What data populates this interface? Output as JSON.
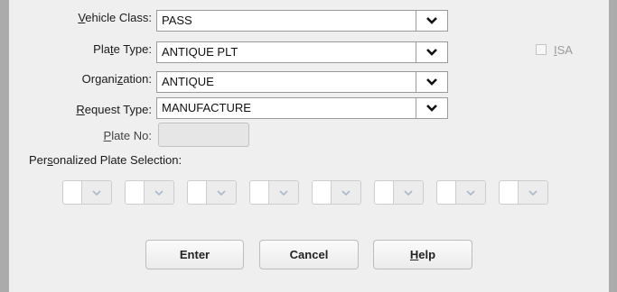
{
  "form": {
    "vehicle_class": {
      "label": "Vehicle Class:",
      "value": "PASS"
    },
    "plate_type": {
      "label": "Plate Type:",
      "value": "ANTIQUE PLT"
    },
    "organization": {
      "label": "Organization:",
      "value": "ANTIQUE"
    },
    "request_type": {
      "label": "Request Type:",
      "value": "MANUFACTURE"
    },
    "plate_no": {
      "label": "Plate No:",
      "value": ""
    },
    "isa": {
      "label": "ISA",
      "checked": false,
      "disabled": true
    },
    "personalized": {
      "label": "Personalized Plate Selection:",
      "slots": [
        "",
        "",
        "",
        "",
        "",
        "",
        "",
        ""
      ]
    }
  },
  "buttons": {
    "enter": "Enter",
    "cancel": "Cancel",
    "help": "Help"
  },
  "icons": {
    "dropdown": "chevron-down-icon",
    "checkbox": "checkbox-icon"
  },
  "colors": {
    "background": "#ababab",
    "panel": "#efefef",
    "field_border": "#9a9a9a"
  }
}
